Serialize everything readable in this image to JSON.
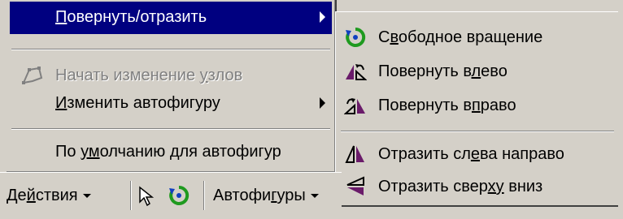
{
  "left_menu": {
    "items": [
      {
        "label_pre": "",
        "label_u": "П",
        "label_post": "овернуть/отразить",
        "state": "selected",
        "has_submenu": true
      },
      {
        "label_pre": "Начать изменение ",
        "label_u": "у",
        "label_post": "злов",
        "state": "disabled",
        "has_submenu": false
      },
      {
        "label_pre": "",
        "label_u": "И",
        "label_post": "зменить автофигуру",
        "state": "normal",
        "has_submenu": true
      },
      {
        "label_pre": "По ",
        "label_u": "ум",
        "label_post": "олчанию для автофигур",
        "state": "normal",
        "has_submenu": false
      }
    ]
  },
  "submenu": {
    "items": [
      {
        "label_pre": "С",
        "label_u": "в",
        "label_post": "ободное вращение",
        "icon": "free-rotate-icon"
      },
      {
        "label_pre": "Повернуть в",
        "label_u": "л",
        "label_post": "ево",
        "icon": "rotate-left-icon"
      },
      {
        "label_pre": "Повернуть в",
        "label_u": "п",
        "label_post": "раво",
        "icon": "rotate-right-icon"
      },
      {
        "label_pre": "Отразить сл",
        "label_u": "е",
        "label_post": "ва направо",
        "icon": "flip-horizontal-icon"
      },
      {
        "label_pre": "Отразить свер",
        "label_u": "ху",
        "label_post": " вниз",
        "icon": "flip-vertical-icon"
      }
    ]
  },
  "toolbar": {
    "actions_pre": "Де",
    "actions_u": "й",
    "actions_post": "ствия",
    "autoshapes_pre": "Автофи",
    "autoshapes_u": "г",
    "autoshapes_post": "уры"
  },
  "colors": {
    "highlight": "#000080",
    "face": "#d4d0c8",
    "accent_green": "#1f9a1f",
    "accent_blue": "#1040c0",
    "accent_purple": "#6a1b6a"
  }
}
